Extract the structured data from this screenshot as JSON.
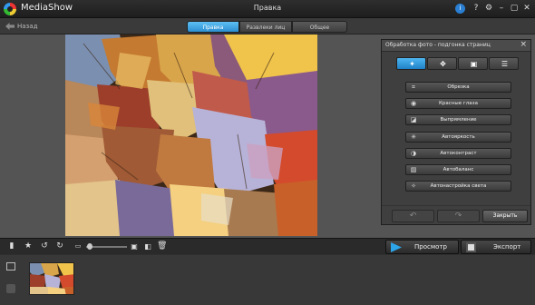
{
  "titlebar": {
    "app_name": "MediaShow",
    "window_title": "Правка",
    "icons": [
      "updates-icon",
      "help-icon",
      "settings-icon",
      "minimize-icon",
      "maximize-icon",
      "close-icon"
    ],
    "help_label": "?",
    "minimize_label": "–",
    "maximize_label": "▢",
    "close_label": "✕",
    "settings_label": "⚙",
    "updates_label": "i"
  },
  "nav": {
    "back_label": "Назад",
    "tabs": [
      {
        "label": "Правка",
        "active": true
      },
      {
        "label": "Развлеки лиц",
        "active": false
      },
      {
        "label": "Общее",
        "active": false
      }
    ]
  },
  "panel": {
    "title": "Обработка фото - подгонка страниц",
    "tab_icons": [
      "magic-wand-icon",
      "move-icon",
      "frame-icon",
      "list-icon"
    ],
    "tools": [
      {
        "label": "Обрезка",
        "icon": "crop-icon"
      },
      {
        "label": "Красные глаза",
        "icon": "eye-icon"
      },
      {
        "label": "Выпрямление",
        "icon": "straighten-icon"
      },
      {
        "label": "Автояркость",
        "icon": "brightness-icon"
      },
      {
        "label": "Автоконтраст",
        "icon": "contrast-icon"
      },
      {
        "label": "Автобаланс",
        "icon": "balance-icon"
      },
      {
        "label": "Автонастройка света",
        "icon": "light-icon"
      }
    ],
    "close_button": "Закрыть"
  },
  "toolbar": {
    "left_icons": [
      "lock-icon",
      "star-icon",
      "rotate-left-icon",
      "rotate-right-icon",
      "screen-icon",
      "zoom-slider",
      "fit-icon",
      "compare-icon",
      "delete-icon"
    ],
    "preview_label": "Просмотр",
    "export_label": "Экспорт"
  },
  "colors": {
    "accent": "#2c9be0",
    "background": "#545454",
    "panel": "#3f3f3f"
  }
}
